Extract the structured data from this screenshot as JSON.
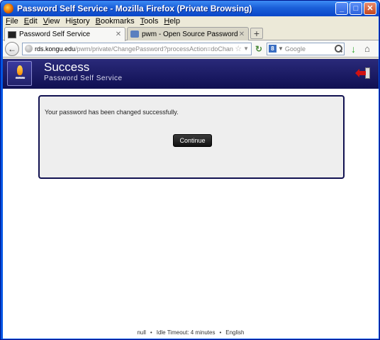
{
  "window": {
    "title": "Password Self Service - Mozilla Firefox (Private Browsing)",
    "minimize": "_",
    "maximize": "□",
    "close": "✕"
  },
  "menu": [
    {
      "u": "F",
      "rest": "ile"
    },
    {
      "u": "E",
      "rest": "dit"
    },
    {
      "u": "V",
      "rest": "iew"
    },
    {
      "u": "",
      "rest": "Hi",
      "u2": "s",
      "rest2": "tory"
    },
    {
      "u": "B",
      "rest": "ookmarks"
    },
    {
      "u": "T",
      "rest": "ools"
    },
    {
      "u": "H",
      "rest": "elp"
    }
  ],
  "tabs": [
    {
      "label": "Password Self Service",
      "close": "✕"
    },
    {
      "label": "pwm - Open Source Password Self Servic...",
      "close": "✕"
    }
  ],
  "new_tab": "+",
  "nav": {
    "url_domain": "rds.kongu.edu",
    "url_path": "/pwm/private/ChangePassword?processAction=doChange&pwmFormI",
    "search_placeholder": "Google",
    "search_engine_letter": "8"
  },
  "page": {
    "title": "Success",
    "subtitle": "Password Self Service",
    "logo_stars": "******",
    "message": "Your password has been changed successfully.",
    "continue_label": "Continue"
  },
  "footer": {
    "locale_null": "null",
    "idle": "Idle Timeout: 4 minutes",
    "language": "English",
    "bullet": "•"
  }
}
